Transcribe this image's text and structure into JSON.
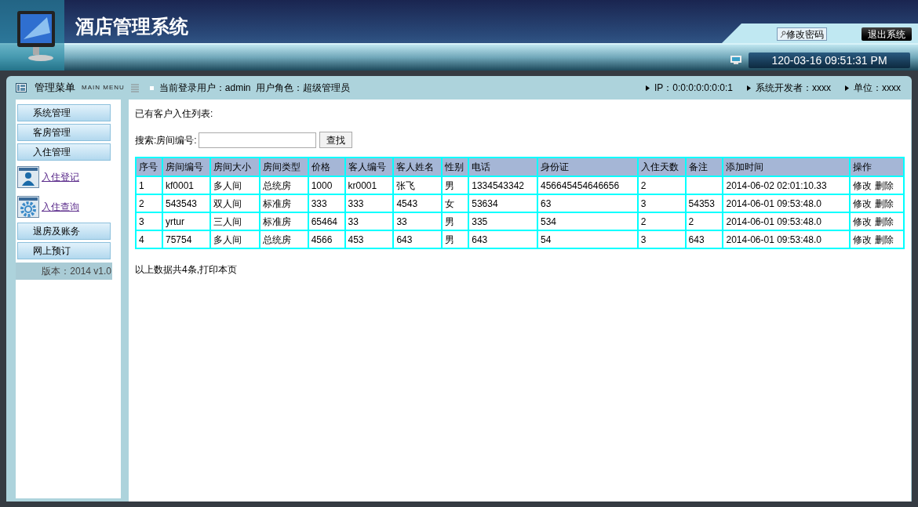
{
  "header": {
    "title": "酒店管理系统",
    "buttons": [
      {
        "label": "修改密码",
        "kind": "key"
      },
      {
        "label": "退出系统",
        "kind": "dark"
      }
    ],
    "clock": "120-03-16 09:51:31 PM"
  },
  "top_bar": {
    "menu_title": "管理菜单",
    "menu_subtitle": "MAIN MENU",
    "user_info": "当前登录用户：admin  用户角色：超级管理员",
    "info_items": [
      "IP：0:0:0:0:0:0:0:1",
      "系统开发者：xxxx",
      "单位：xxxx"
    ]
  },
  "sidebar": {
    "items": [
      {
        "kind": "section",
        "label": "系统管理"
      },
      {
        "kind": "section",
        "label": "客房管理"
      },
      {
        "kind": "section",
        "label": "入住管理"
      },
      {
        "kind": "link",
        "label": "入住登记"
      },
      {
        "kind": "link",
        "label": "入住查询"
      },
      {
        "kind": "section",
        "label": "退房及账务"
      },
      {
        "kind": "section",
        "label": "网上预订"
      }
    ],
    "version": "版本：2014 v1.0"
  },
  "content": {
    "heading": "已有客户入住列表:",
    "search_label": "搜索:房间编号:",
    "search_button": "查找",
    "table": {
      "columns": [
        "序号",
        "房间编号",
        "房间大小",
        "房间类型",
        "价格",
        "客人编号",
        "客人姓名",
        "性别",
        "电话",
        "身份证",
        "入住天数",
        "备注",
        "添加时间",
        "操作"
      ],
      "rows": [
        {
          "cells": [
            "1",
            "kf0001",
            "多人间",
            "总统房",
            "1000",
            "kr0001",
            "张飞",
            "男",
            "1334543342",
            "456645454646656",
            "2",
            "",
            "2014-06-02 02:01:10.33"
          ],
          "actions": [
            "修改",
            "删除"
          ]
        },
        {
          "cells": [
            "2",
            "543543",
            "双人间",
            "标准房",
            "333",
            "333",
            "4543",
            "女",
            "53634",
            "63",
            "3",
            "54353",
            "2014-06-01 09:53:48.0"
          ],
          "actions": [
            "修改",
            "删除"
          ]
        },
        {
          "cells": [
            "3",
            "yrtur",
            "三人间",
            "标准房",
            "65464",
            "33",
            "33",
            "男",
            "335",
            "534",
            "2",
            "2",
            "2014-06-01 09:53:48.0"
          ],
          "actions": [
            "修改",
            "删除"
          ]
        },
        {
          "cells": [
            "4",
            "75754",
            "多人间",
            "总统房",
            "4566",
            "453",
            "643",
            "男",
            "643",
            "54",
            "3",
            "643",
            "2014-06-01 09:53:48.0"
          ],
          "actions": [
            "修改",
            "删除"
          ]
        }
      ]
    },
    "footer": "以上数据共4条,打印本页"
  }
}
